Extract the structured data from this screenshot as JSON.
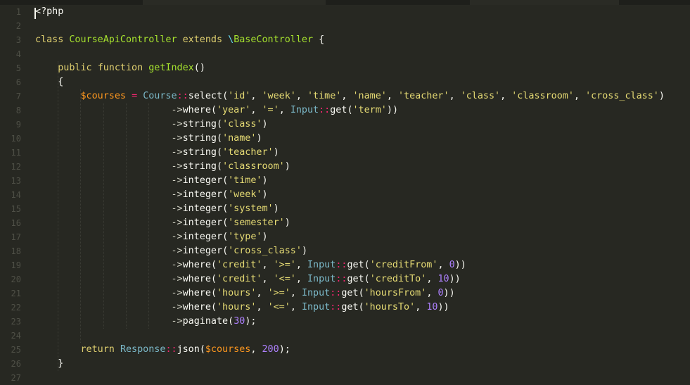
{
  "editor": {
    "language": "PHP",
    "colors": {
      "background": "#272822",
      "gutter_text": "#4f5047",
      "keyword": "#dfcf6f",
      "class_name": "#a6e22e",
      "string": "#e6db74",
      "variable": "#fd971f",
      "operator": "#f92672",
      "number": "#ae81ff"
    },
    "line_numbers": [
      "1",
      "2",
      "3",
      "4",
      "5",
      "6",
      "7",
      "8",
      "9",
      "10",
      "11",
      "12",
      "13",
      "14",
      "15",
      "16",
      "17",
      "18",
      "19",
      "20",
      "21",
      "22",
      "23",
      "24",
      "25",
      "26",
      "27"
    ],
    "lines": [
      "<?php",
      "",
      "class CourseApiController extends \\BaseController {",
      "",
      "    public function getIndex()",
      "    {",
      "        $courses = Course::select('id', 'week', 'time', 'name', 'teacher', 'class', 'classroom', 'cross_class')",
      "                        ->where('year', '=', Input::get('term'))",
      "                        ->string('class')",
      "                        ->string('name')",
      "                        ->string('teacher')",
      "                        ->string('classroom')",
      "                        ->integer('time')",
      "                        ->integer('week')",
      "                        ->integer('system')",
      "                        ->integer('semester')",
      "                        ->integer('type')",
      "                        ->integer('cross_class')",
      "                        ->where('credit', '>=', Input::get('creditFrom', 0))",
      "                        ->where('credit', '<=', Input::get('creditTo', 10))",
      "                        ->where('hours', '>=', Input::get('hoursFrom', 0))",
      "                        ->where('hours', '<=', Input::get('hoursTo', 10))",
      "                        ->paginate(30);",
      "",
      "        return Response::json($courses, 200);",
      "    }",
      ""
    ]
  }
}
